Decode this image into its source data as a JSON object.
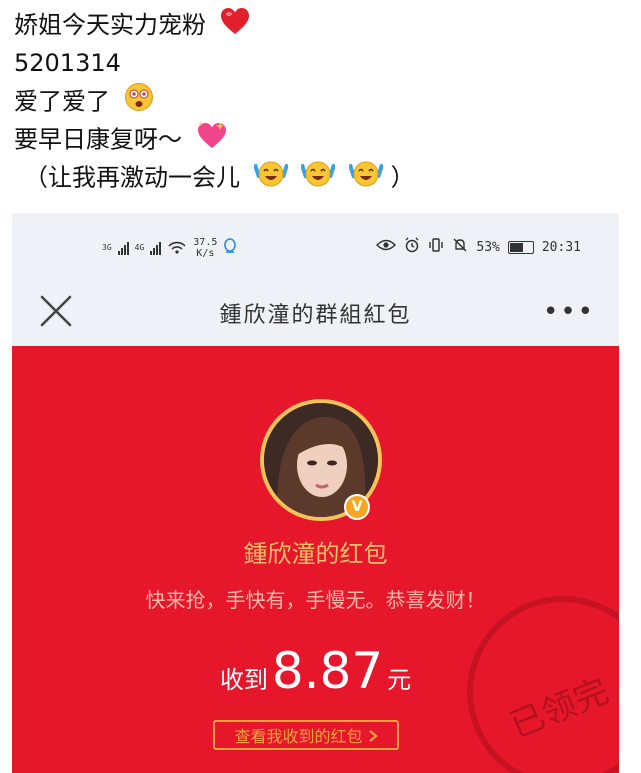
{
  "caption": {
    "line1": "娇姐今天实力宠粉",
    "line2": "5201314",
    "line3": "爱了爱了",
    "line4": "要早日康复呀～",
    "line5": "（让我再激动一会儿",
    "line5_close": "）"
  },
  "icons": {
    "heart": "red-heart-icon",
    "astonished": "astonished-face-icon",
    "sparkling_heart": "sparkling-heart-icon",
    "cheering": "cheering-face-icon"
  },
  "status_bar": {
    "net1": "3G",
    "net2": "4G",
    "speed_value": "37.5",
    "speed_unit": "K/s",
    "battery": "53%",
    "time": "20:31"
  },
  "nav": {
    "title": "鍾欣潼的群組紅包",
    "more": "•••"
  },
  "packet": {
    "sender": "鍾欣潼的红包",
    "greeting": "快来抢，手快有，手慢无。恭喜发财！",
    "received_label": "收到",
    "amount": "8.87",
    "unit": "元",
    "view_button": "查看我收到的红包",
    "stamp": "已领完",
    "accent": "#e6172b"
  }
}
